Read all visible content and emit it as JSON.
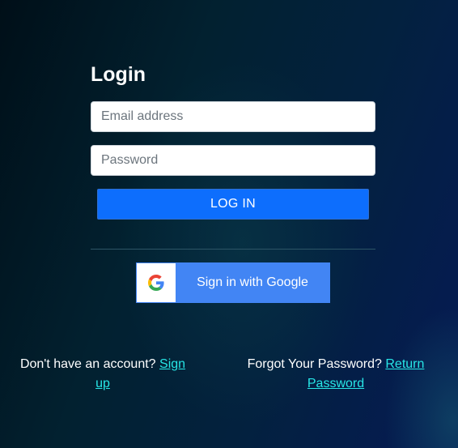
{
  "login": {
    "title": "Login",
    "email_placeholder": "Email address",
    "password_placeholder": "Password",
    "login_button": "LOG IN"
  },
  "google": {
    "label": "Sign in with Google",
    "icon": "google-g-icon"
  },
  "footer": {
    "signup_prompt": "Don't have an account?",
    "signup_link": "Sign up",
    "forgot_prompt": "Forgot Your Password?",
    "forgot_link": "Return Password"
  },
  "colors": {
    "primary_button": "#0d6efd",
    "google_button": "#4285f4",
    "link": "#27e6e6"
  }
}
